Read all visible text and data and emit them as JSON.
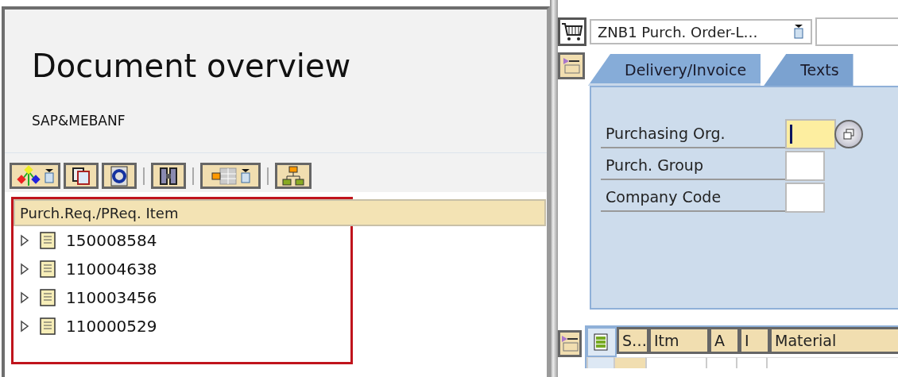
{
  "overview": {
    "title": "Document overview",
    "subtitle": "SAP&MEBANF"
  },
  "toolbar": [
    {
      "kind": "variant"
    },
    {
      "kind": "copy"
    },
    {
      "kind": "refresh"
    },
    {
      "kind": "sep"
    },
    {
      "kind": "find"
    },
    {
      "kind": "sep"
    },
    {
      "kind": "layout"
    },
    {
      "kind": "sep"
    },
    {
      "kind": "hierarchy"
    }
  ],
  "tree": {
    "header": "Purch.Req./PReq. Item",
    "highlighted": true,
    "items": [
      {
        "label": "150008584",
        "expanded": false
      },
      {
        "label": "110004638",
        "expanded": false
      },
      {
        "label": "110003456",
        "expanded": false
      },
      {
        "label": "110000529",
        "expanded": false
      }
    ]
  },
  "doc_type": {
    "value": "ZNB1 Purch. Order-L…"
  },
  "tabs": [
    {
      "label": "Delivery/Invoice",
      "selected": true
    },
    {
      "label": "Texts",
      "selected": false
    }
  ],
  "fields": [
    {
      "label": "Purchasing Org.",
      "focused": true,
      "help": true
    },
    {
      "label": "Purch. Group",
      "focused": false
    },
    {
      "label": "Company Code",
      "focused": false
    }
  ],
  "items_table": {
    "columns": [
      "S…",
      "Itm",
      "A",
      "I",
      "Material"
    ]
  }
}
